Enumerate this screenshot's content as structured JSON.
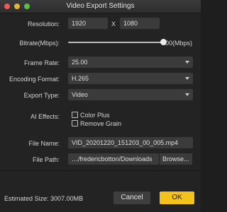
{
  "window": {
    "title": "Video Export Settings"
  },
  "resolution": {
    "label": "Resolution:",
    "width": "1920",
    "separator": "X",
    "height": "1080"
  },
  "bitrate": {
    "label": "Bitrate(Mbps):",
    "value_text": "200(Mbps)",
    "level_fraction": 1.0
  },
  "frame_rate": {
    "label": "Frame Rate:",
    "value": "25.00"
  },
  "encoding": {
    "label": "Encoding Format:",
    "value": "H.265"
  },
  "export_type": {
    "label": "Export Type:",
    "value": "Video"
  },
  "ai_effects": {
    "label": "AI Effects:",
    "options": [
      {
        "label": "Color Plus",
        "checked": false
      },
      {
        "label": "Remove Grain",
        "checked": false
      }
    ]
  },
  "file_name": {
    "label": "File Name:",
    "value": "VID_20201220_151203_00_005.mp4"
  },
  "file_path": {
    "label": "File Path:",
    "value": "…/fredericbotton/Downloads",
    "browse_label": "Browse..."
  },
  "footer": {
    "estimated_size_label": "Estimated Size:",
    "estimated_size_value": "3007.00MB",
    "cancel_label": "Cancel",
    "ok_label": "OK"
  },
  "colors": {
    "accent": "#f3c21c"
  }
}
